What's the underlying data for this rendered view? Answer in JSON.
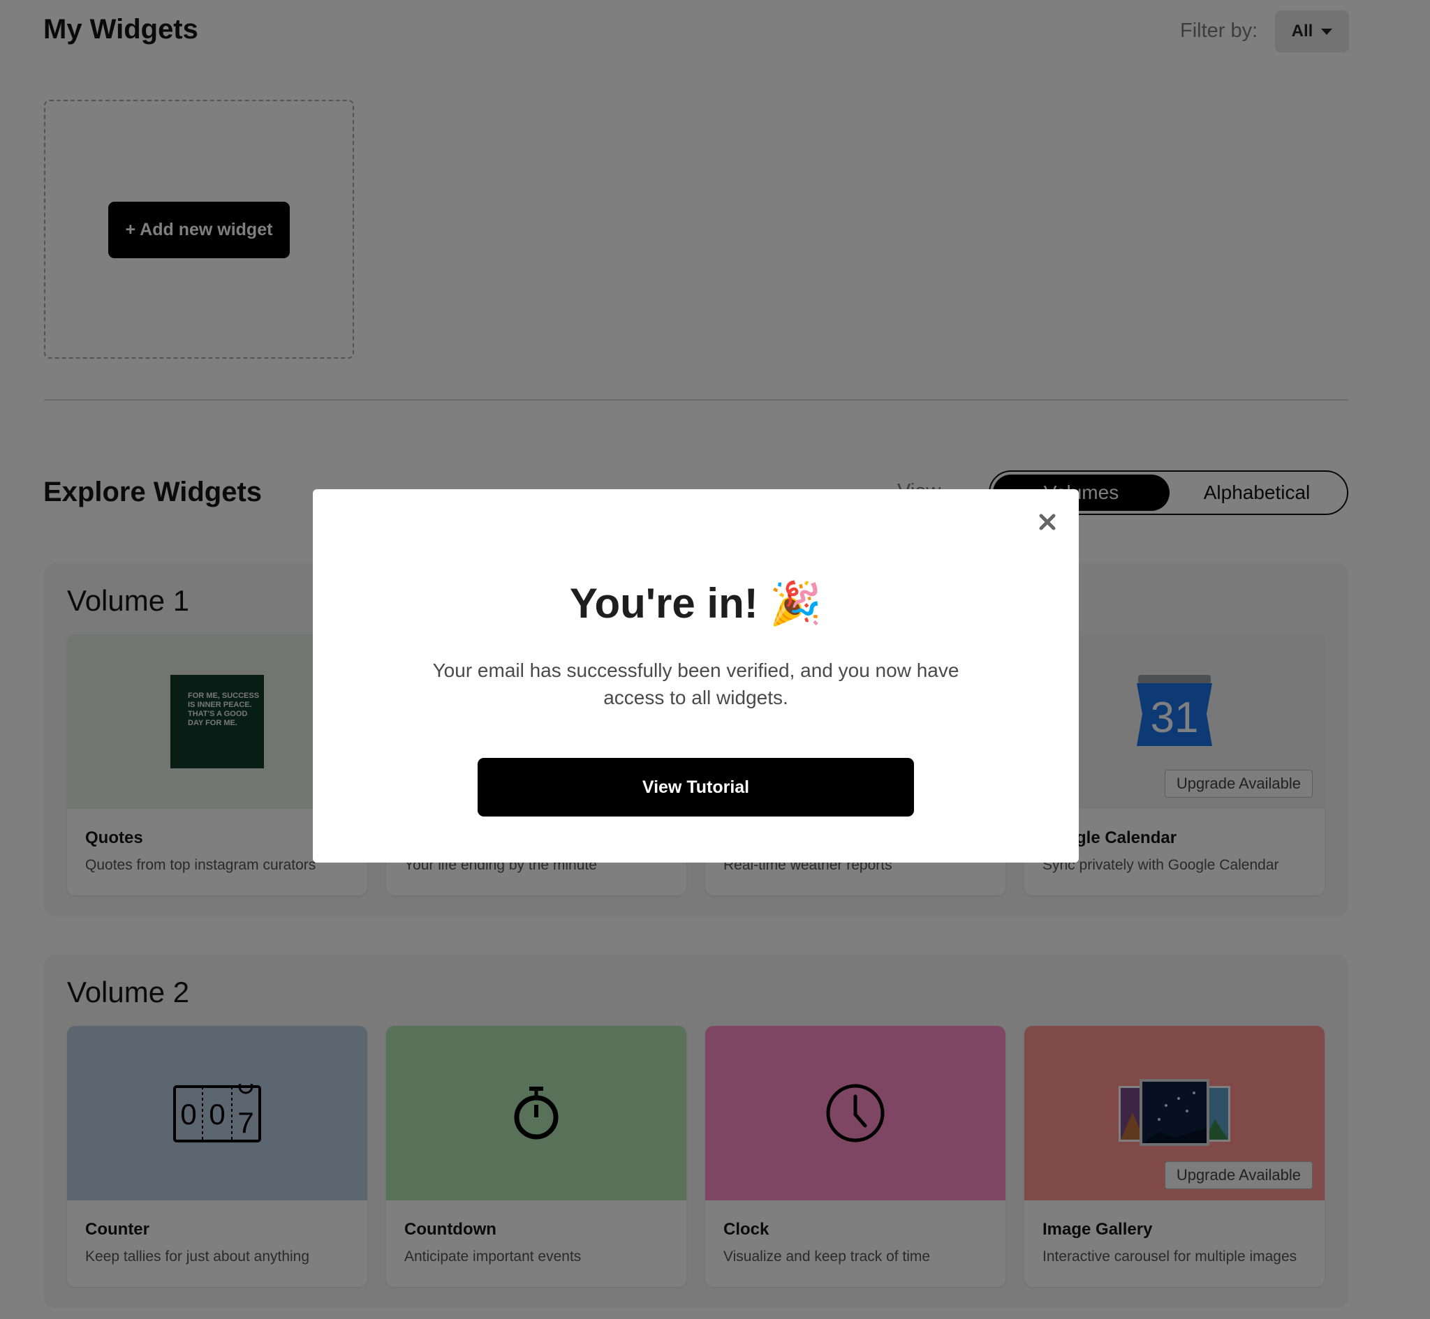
{
  "header": {
    "title": "My Widgets",
    "filter_label": "Filter by:",
    "filter_value": "All"
  },
  "my_widgets": {
    "add_button_label": "+ Add new widget"
  },
  "explore": {
    "title": "Explore Widgets",
    "view_label": "View",
    "view_options": [
      "Volumes",
      "Alphabetical"
    ],
    "active_view": "Volumes"
  },
  "volumes": [
    {
      "title": "Volume 1",
      "cards": [
        {
          "title": "Quotes",
          "description": "Quotes from top instagram curators",
          "poster_text": "For me, success is inner peace. That's a good day for me.",
          "bg": "#e4ebe0"
        },
        {
          "title": "",
          "description": "Your life ending by the minute",
          "bg": "#ffffff"
        },
        {
          "title": "",
          "description": "Real-time weather reports",
          "bg": "#ffffff"
        },
        {
          "title": "Google Calendar",
          "description": "Sync privately with Google Calendar",
          "calendar_day": "31",
          "badge": "Upgrade Available",
          "bg": "#f0f0f0"
        }
      ]
    },
    {
      "title": "Volume 2",
      "cards": [
        {
          "title": "Counter",
          "description": "Keep tallies for just about anything",
          "counter_digits": [
            "0",
            "0",
            "7"
          ],
          "bg": "#b9cde1"
        },
        {
          "title": "Countdown",
          "description": "Anticipate important events",
          "bg": "#b0e3b2"
        },
        {
          "title": "Clock",
          "description": "Visualize and keep track of time",
          "bg": "#ff8cc7"
        },
        {
          "title": "Image Gallery",
          "description": "Interactive carousel for multiple images",
          "badge": "Upgrade Available",
          "bg": "#ff9591"
        }
      ]
    }
  ],
  "modal": {
    "title": "You're in! 🎉",
    "body": "Your email has successfully been verified, and you now have access to all widgets.",
    "button_label": "View Tutorial",
    "close_icon": "close-icon"
  },
  "colors": {
    "overlay": "rgba(0,0,0,0.5)",
    "primary_button": "#000000"
  }
}
